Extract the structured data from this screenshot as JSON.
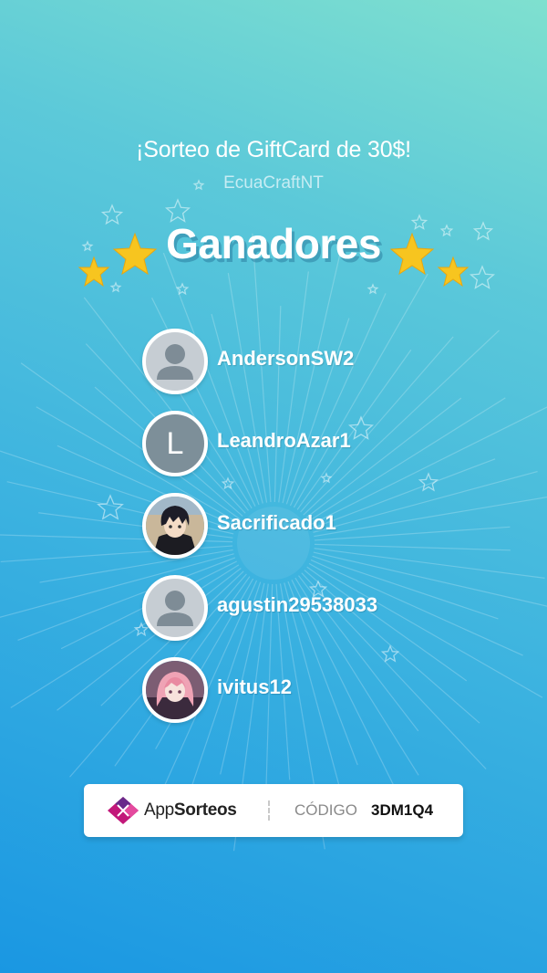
{
  "header": {
    "title": "¡Sorteo de GiftCard de 30$!",
    "organizer": "EcuaCraftNT",
    "heading": "Ganadores"
  },
  "winners": [
    {
      "name": "AndersonSW2",
      "avatar": "default-user-icon"
    },
    {
      "name": "LeandroAzar1",
      "avatar": "letter",
      "initial": "L"
    },
    {
      "name": "Sacrificado1",
      "avatar": "anime-boy-photo"
    },
    {
      "name": "agustin29538033",
      "avatar": "default-user-icon"
    },
    {
      "name": "ivitus12",
      "avatar": "anime-girl-photo"
    }
  ],
  "footer": {
    "brand_prefix": "App",
    "brand_suffix": "Sorteos",
    "code_label": "CÓDIGO",
    "code_value": "3DM1Q4"
  },
  "colors": {
    "bg_top": "#7fe0cf",
    "bg_bottom": "#1a97e2",
    "star": "#f7c51f",
    "logo_pink": "#c2187a",
    "logo_purple": "#6a2a8a"
  }
}
